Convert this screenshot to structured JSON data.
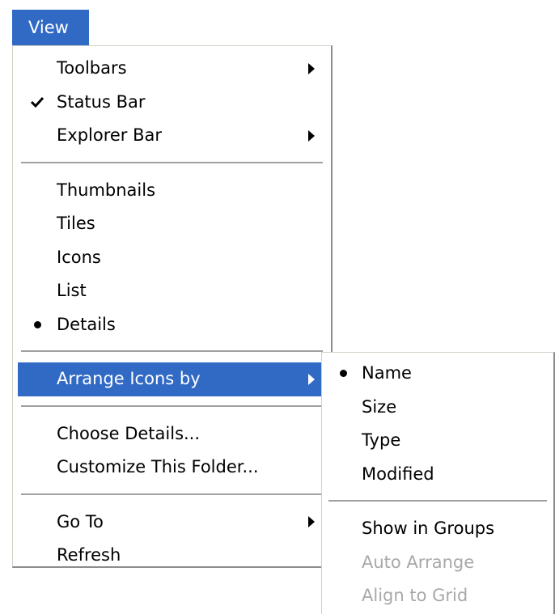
{
  "menubar": {
    "view_label": "View"
  },
  "view_menu": {
    "group1": {
      "toolbars": "Toolbars",
      "status_bar": "Status Bar",
      "explorer_bar": "Explorer Bar"
    },
    "group2": {
      "thumbnails": "Thumbnails",
      "tiles": "Tiles",
      "icons": "Icons",
      "list": "List",
      "details": "Details"
    },
    "group3": {
      "arrange_icons_by": "Arrange Icons by"
    },
    "group4": {
      "choose_details": "Choose Details...",
      "customize_folder": "Customize This Folder..."
    },
    "group5": {
      "go_to": "Go To",
      "refresh": "Refresh"
    },
    "checked_item": "Status Bar",
    "selected_view": "Details",
    "highlighted_item": "Arrange Icons by"
  },
  "arrange_submenu": {
    "sort": {
      "name": "Name",
      "size": "Size",
      "type": "Type",
      "modified": "Modified"
    },
    "options": {
      "show_in_groups": "Show in Groups",
      "auto_arrange": "Auto Arrange",
      "align_to_grid": "Align to Grid"
    },
    "selected_sort": "Name",
    "disabled_items": [
      "Auto Arrange",
      "Align to Grid"
    ]
  },
  "colors": {
    "highlight": "#316ac5",
    "disabled_text": "#a8a8a8"
  }
}
